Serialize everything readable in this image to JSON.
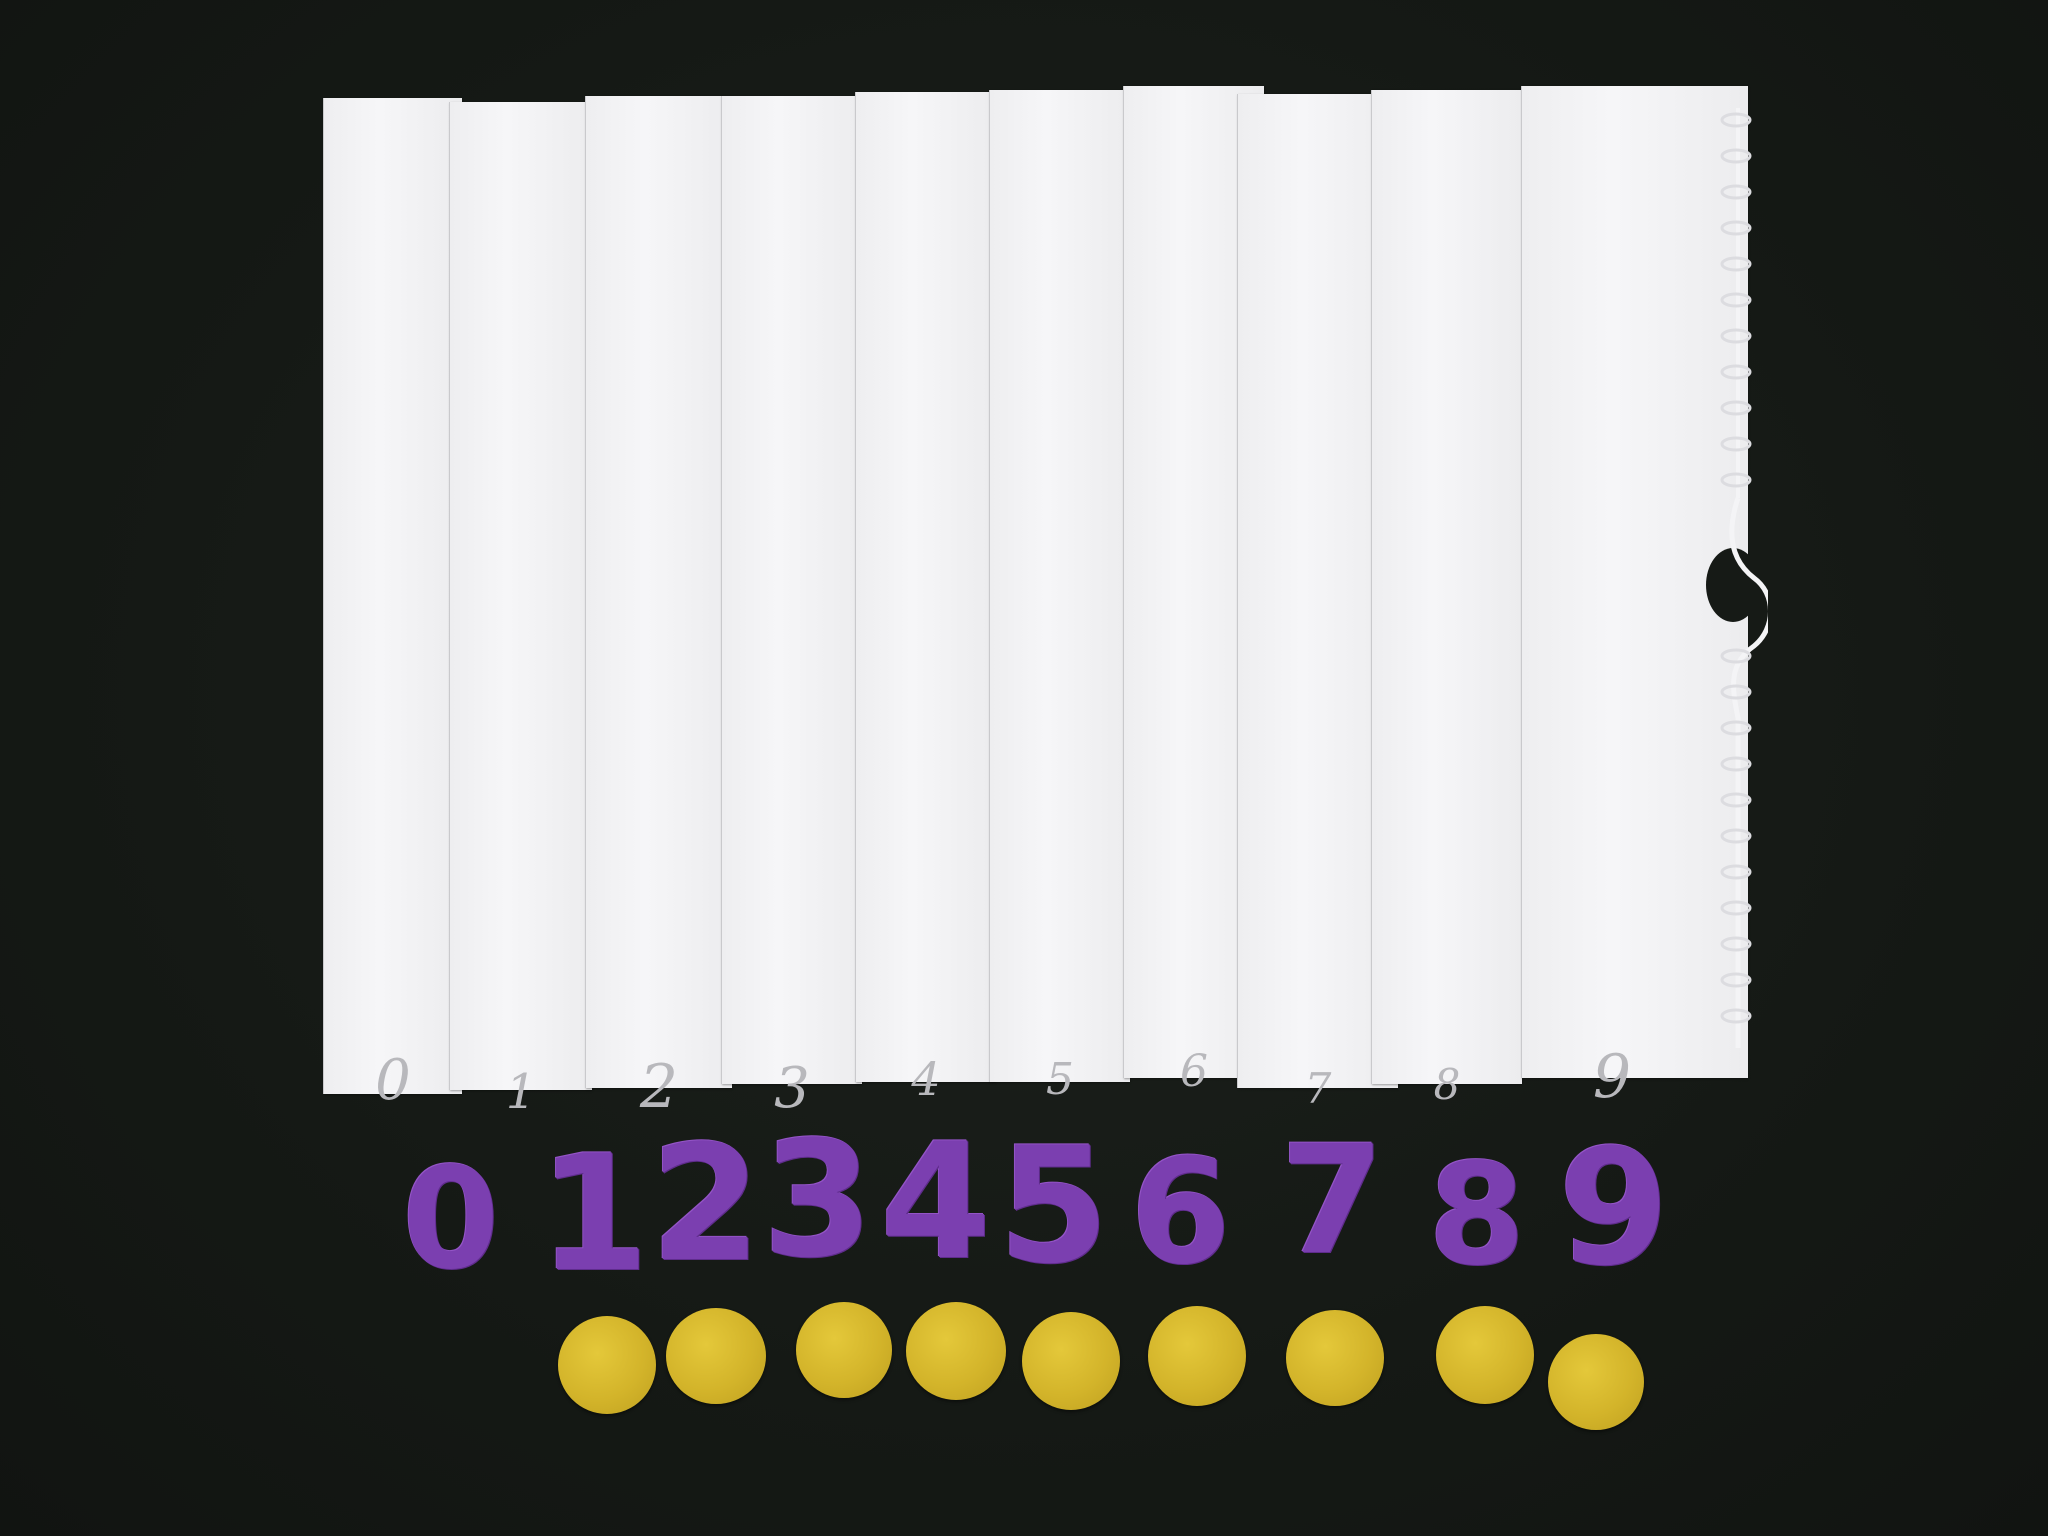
{
  "strips": [
    {
      "label": "0"
    },
    {
      "label": "1"
    },
    {
      "label": "2"
    },
    {
      "label": "3"
    },
    {
      "label": "4"
    },
    {
      "label": "5"
    },
    {
      "label": "6"
    },
    {
      "label": "7"
    },
    {
      "label": "8"
    },
    {
      "label": "9"
    }
  ],
  "felt_digits": [
    "0",
    "1",
    "2",
    "3",
    "4",
    "5",
    "6",
    "7",
    "8",
    "9"
  ],
  "felt_dot_count": 9,
  "colors": {
    "background": "#161a16",
    "paper": "#f2f2f4",
    "felt_digit": "#7b3fb0",
    "felt_dot": "#d3b42a"
  }
}
